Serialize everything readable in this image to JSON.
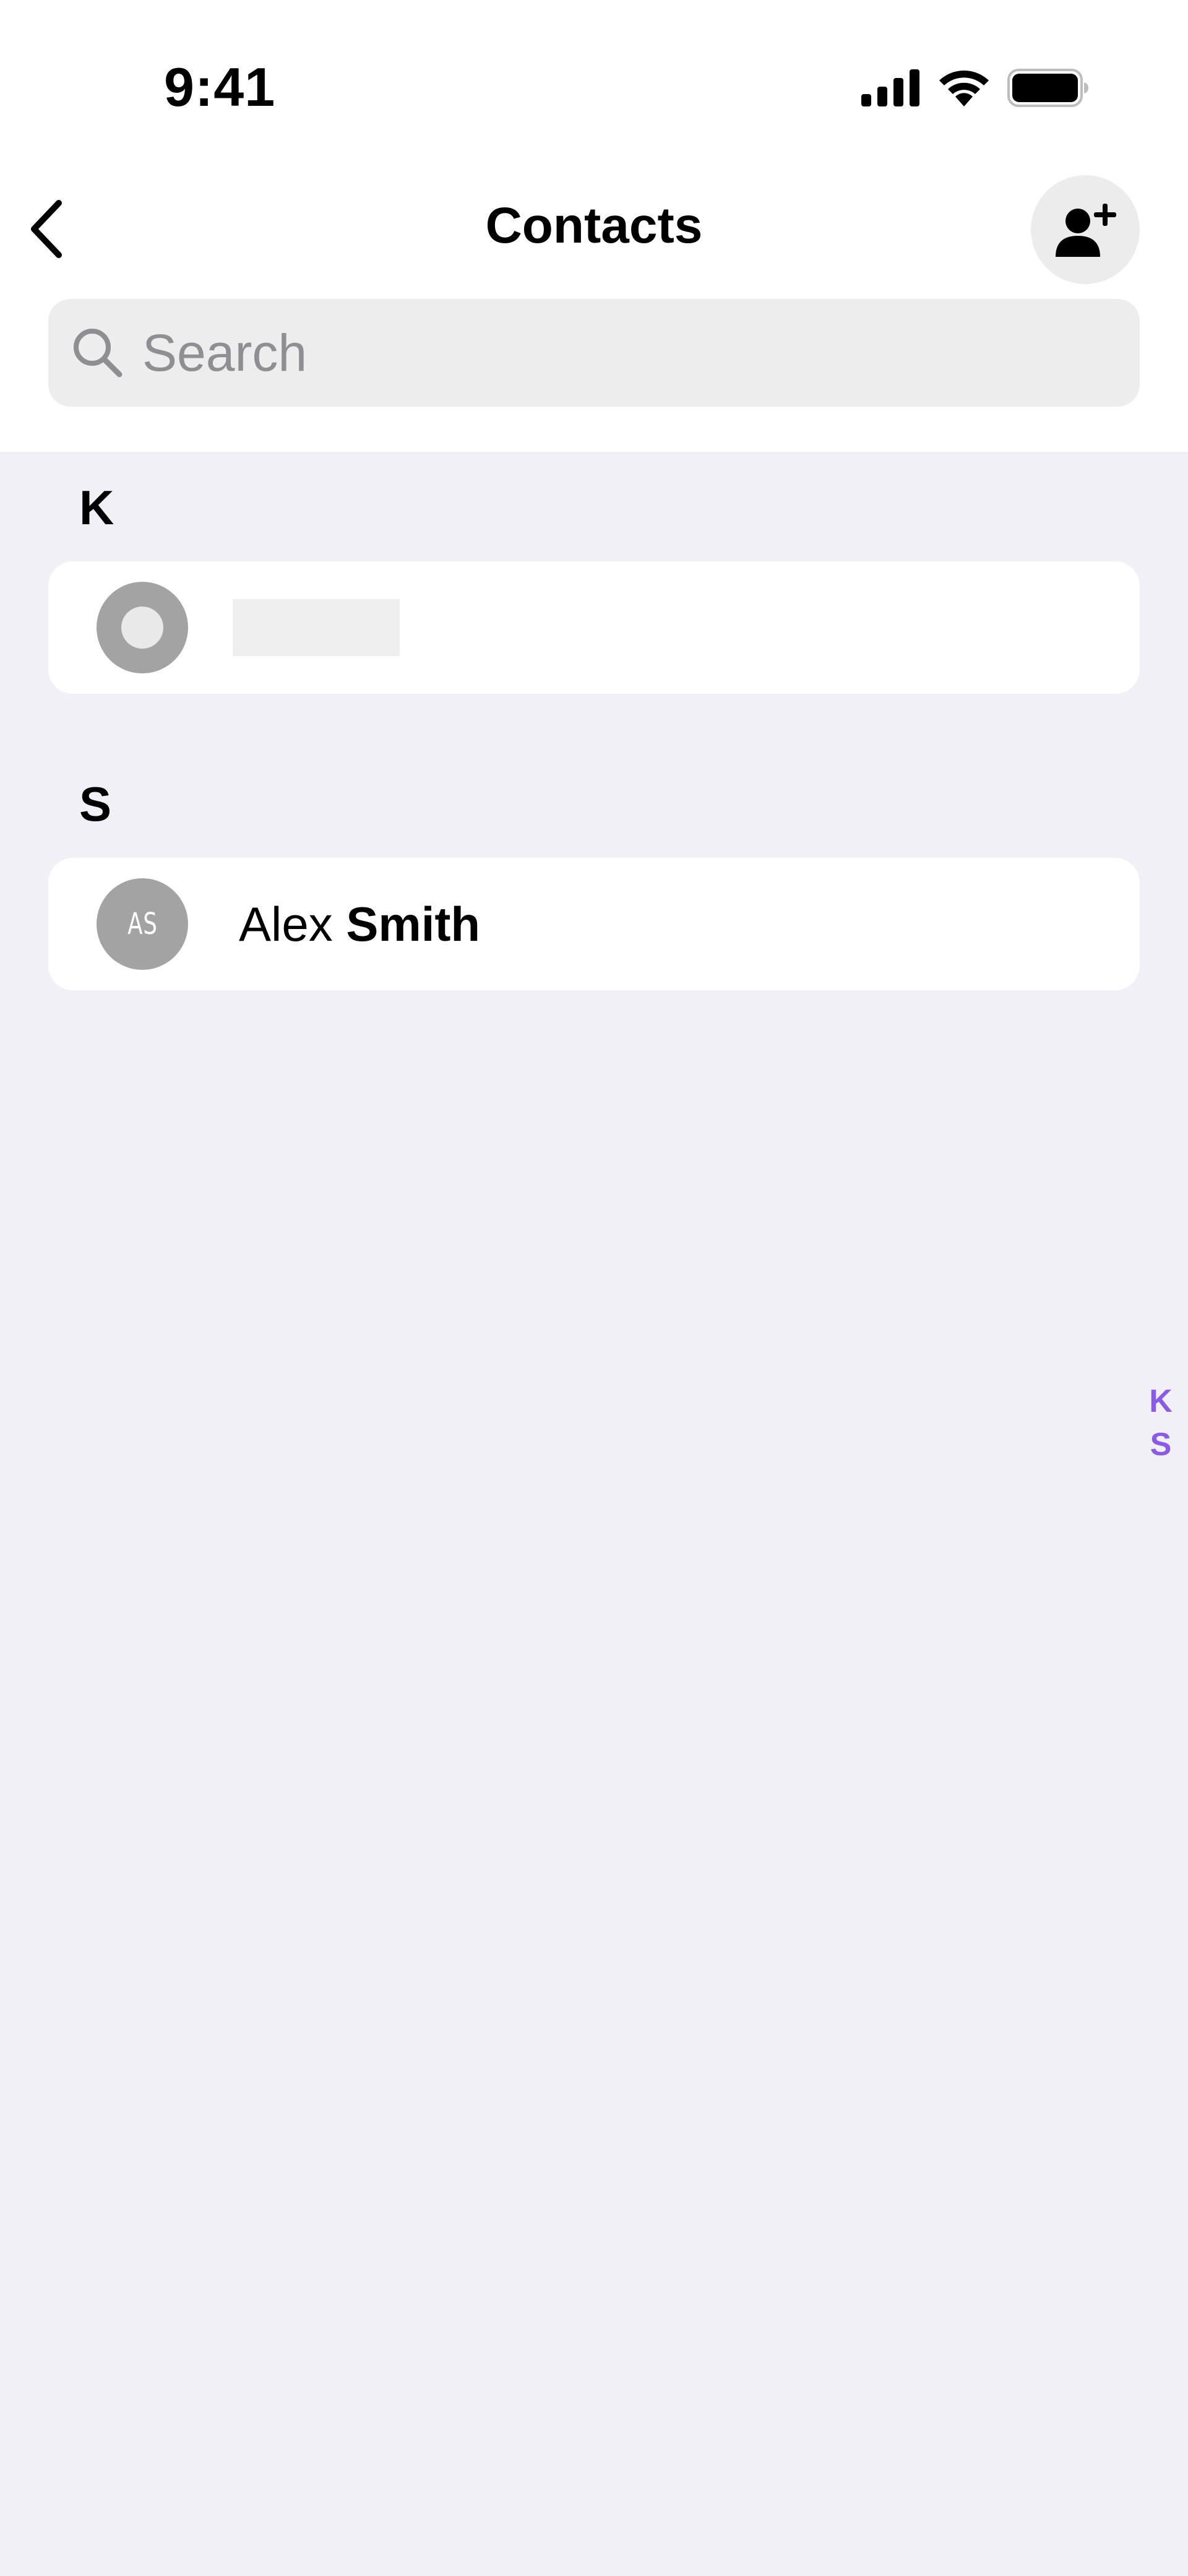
{
  "status_bar": {
    "time": "9:41",
    "icons": [
      "cellular-signal-icon",
      "wifi-icon",
      "battery-icon"
    ]
  },
  "nav": {
    "title": "Contacts",
    "back_icon": "chevron-left-icon",
    "add_contact_icon": "person-add-icon"
  },
  "search": {
    "placeholder": "Search",
    "value": ""
  },
  "sections": [
    {
      "letter": "K",
      "contacts": [
        {
          "placeholder": true,
          "avatar": "placeholder",
          "first_name": "",
          "last_name": ""
        }
      ]
    },
    {
      "letter": "S",
      "contacts": [
        {
          "initials": "AS",
          "first_name": "Alex",
          "last_name": "Smith"
        }
      ]
    }
  ],
  "index_letters": [
    "K",
    "S"
  ],
  "colors": {
    "background": "#f1f0f6",
    "surface": "#ffffff",
    "avatar": "#a3a3a3",
    "accent_index": "#8a5ce6",
    "search_field": "#ededed"
  }
}
